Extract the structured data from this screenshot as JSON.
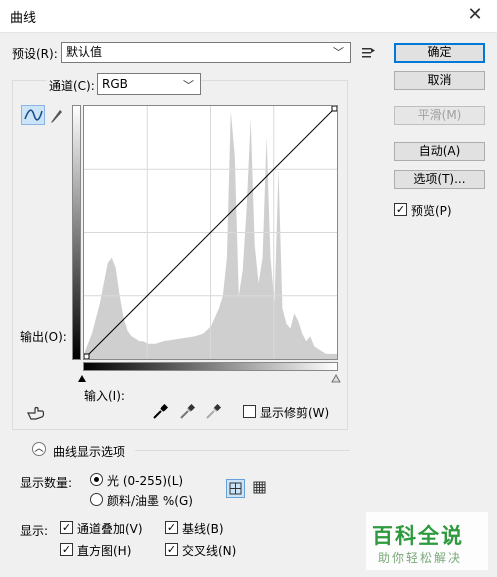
{
  "window": {
    "title": "曲线"
  },
  "preset": {
    "label": "预设(R):",
    "value": "默认值"
  },
  "channel": {
    "label": "通道(C):",
    "value": "RGB"
  },
  "output_label": "输出(O):",
  "input_label": "输入(I):",
  "buttons": {
    "ok": "确定",
    "cancel": "取消",
    "smooth": "平滑(M)",
    "auto": "自动(A)",
    "options": "选项(T)..."
  },
  "preview": {
    "label": "预览(P)",
    "checked": true
  },
  "show_clipping": {
    "label": "显示修剪(W)",
    "checked": false
  },
  "curve_display_options": "曲线显示选项",
  "show_amount": {
    "label": "显示数量:",
    "light": "光 (0-255)(L)",
    "pigment": "颜料/油墨 %(G)",
    "selected": "light"
  },
  "show": {
    "label": "显示:",
    "channel_overlays": "通道叠加(V)",
    "baseline": "基线(B)",
    "histogram": "直方图(H)",
    "intersection": "交叉线(N)"
  },
  "watermark": {
    "line1": "百科全说",
    "line2": "助你轻松解决"
  },
  "chart_data": {
    "type": "area",
    "xlim": [
      0,
      255
    ],
    "ylim": [
      0,
      1
    ],
    "x": [
      0,
      8,
      16,
      20,
      24,
      28,
      32,
      36,
      40,
      44,
      48,
      52,
      56,
      60,
      64,
      72,
      80,
      96,
      112,
      120,
      128,
      136,
      140,
      144,
      148,
      152,
      156,
      160,
      164,
      168,
      172,
      176,
      180,
      184,
      188,
      192,
      196,
      200,
      204,
      208,
      212,
      216,
      220,
      224,
      228,
      232,
      236,
      240,
      244,
      248,
      252,
      255
    ],
    "values": [
      0.02,
      0.1,
      0.22,
      0.3,
      0.38,
      0.4,
      0.36,
      0.25,
      0.16,
      0.11,
      0.09,
      0.08,
      0.07,
      0.07,
      0.06,
      0.06,
      0.07,
      0.08,
      0.09,
      0.1,
      0.13,
      0.2,
      0.25,
      0.4,
      0.98,
      0.8,
      0.25,
      0.35,
      0.6,
      0.95,
      0.45,
      0.3,
      0.4,
      0.88,
      0.4,
      0.22,
      0.75,
      0.2,
      0.14,
      0.12,
      0.18,
      0.15,
      0.1,
      0.07,
      0.09,
      0.05,
      0.04,
      0.03,
      0.02,
      0.02,
      0.02,
      0.02
    ]
  }
}
